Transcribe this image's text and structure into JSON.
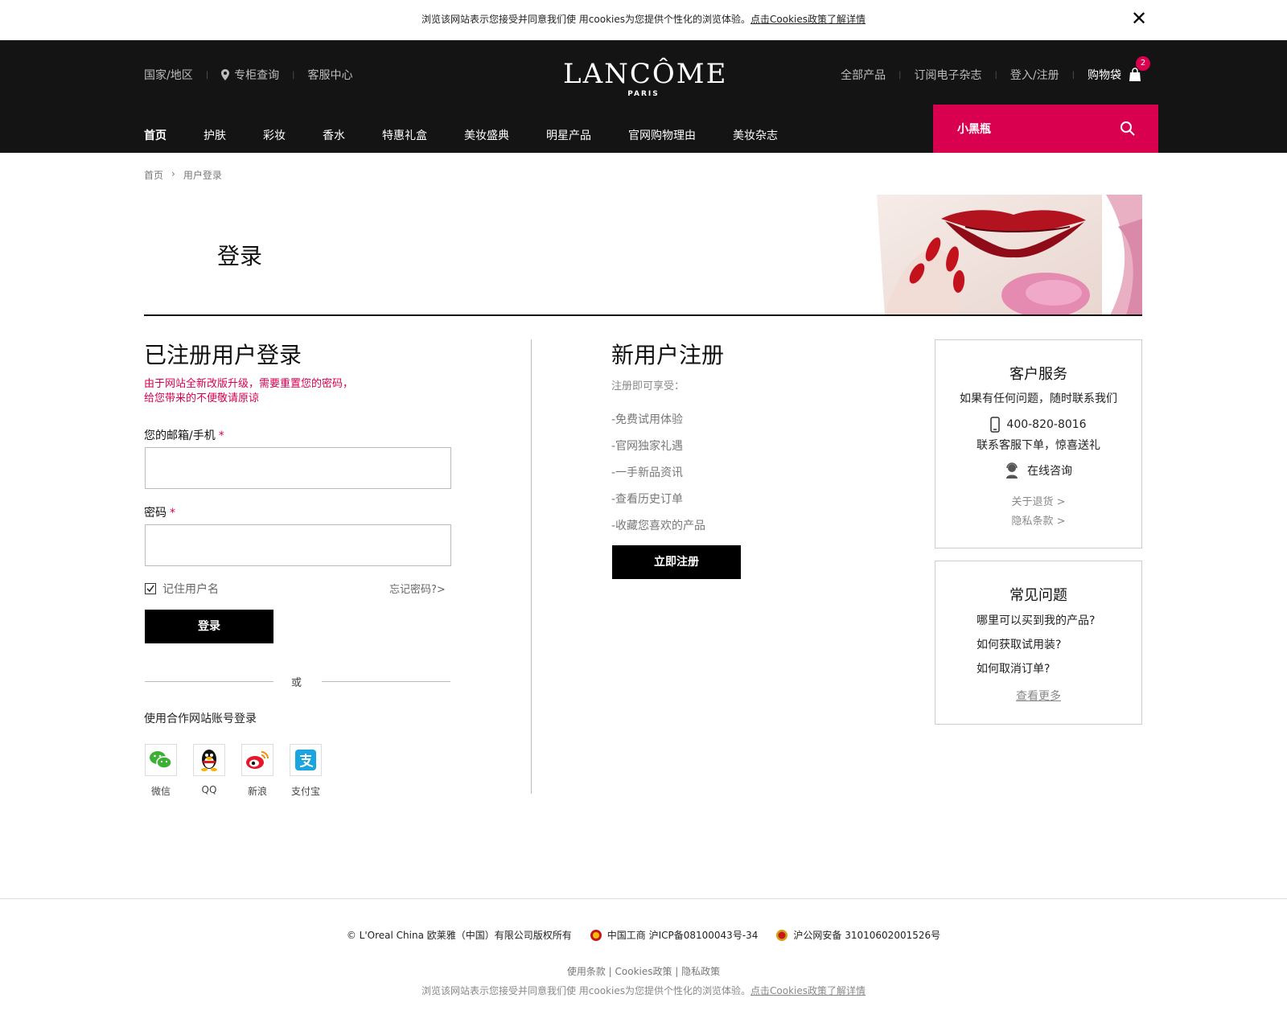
{
  "cookie_bar": {
    "text": "浏览该网站表示您接受并同意我们使 用cookies为您提供个性化的浏览体验。",
    "link": "点击Cookies政策了解详情",
    "close": "✕"
  },
  "header": {
    "util_left": [
      "国家/地区",
      "专柜查询",
      "客服中心"
    ],
    "logo_main": "LANCÔME",
    "logo_sub": "PARIS",
    "util_right": [
      "全部产品",
      "订阅电子杂志",
      "登入/注册"
    ],
    "cart_label": "购物袋",
    "cart_count": "2",
    "nav": [
      "首页",
      "护肤",
      "彩妆",
      "香水",
      "特惠礼盒",
      "美妆盛典",
      "明星产品",
      "官网购物理由",
      "美妆杂志"
    ],
    "search_value": "小黑瓶"
  },
  "breadcrumb": [
    "首页",
    "›",
    "用户登录"
  ],
  "page_title": "登录",
  "login": {
    "title": "已注册用户登录",
    "notice_line1": "由于网站全新改版升级，需要重置您的密码，",
    "notice_line2": "给您带来的不便敬请原谅",
    "email_label": "您的邮箱/手机",
    "password_label": "密码",
    "required_mark": "*",
    "remember_label": "记住用户名",
    "forgot_label": "忘记密码?>",
    "submit_label": "登录",
    "or_label": "或",
    "partner_label": "使用合作网站账号登录",
    "social": [
      "微信",
      "QQ",
      "新浪",
      "支付宝"
    ]
  },
  "register": {
    "title": "新用户注册",
    "subtitle": "注册即可享受：",
    "benefits": [
      "-免费试用体验",
      "-官网独家礼遇",
      "-一手新品资讯",
      "-查看历史订单",
      "-收藏您喜欢的产品"
    ],
    "button_label": "立即注册"
  },
  "service": {
    "title": "客户服务",
    "subtitle": "如果有任何问题，随时联系我们",
    "phone": "400-820-8016",
    "phone_note": "联系客服下单，惊喜送礼",
    "online": "在线咨询",
    "links": [
      "关于退货 >",
      "隐私条款 >"
    ]
  },
  "faq": {
    "title": "常见问题",
    "items": [
      "哪里可以买到我的产品?",
      "如何获取试用装?",
      "如何取消订单?"
    ],
    "more": "查看更多"
  },
  "footer": {
    "copyright": "© L'Oreal China 欧莱雅（中国）有限公司版权所有",
    "icp": "中国工商 沪ICP备08100043号-34",
    "police": "沪公网安备 31010602001526号",
    "links": "使用条款 | Cookies政策 | 隐私政策",
    "note_text": "浏览该网站表示您接受并同意我们使 用cookies为您提供个性化的浏览体验。",
    "note_link": "点击Cookies政策了解详情"
  },
  "colors": {
    "brand_pink": "#d8004f",
    "header_bg": "#141414"
  }
}
